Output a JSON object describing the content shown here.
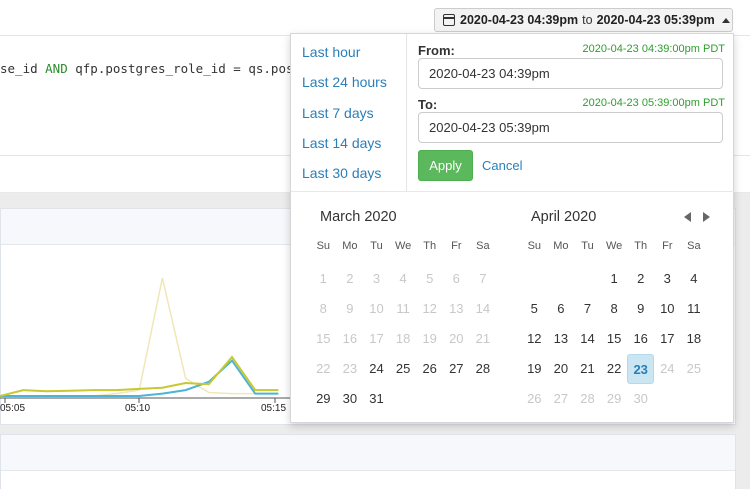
{
  "background": {
    "query_prefix": "se_id ",
    "query_and": "AND",
    "query_rest": " qfp.postgres_role_id = qs.postgr",
    "ticks": [
      "05:05",
      "05:10",
      "05:15"
    ]
  },
  "range_button": {
    "from": "2020-04-23 04:39pm",
    "to_word": "to",
    "to": "2020-04-23 05:39pm"
  },
  "presets": [
    "Last hour",
    "Last 24 hours",
    "Last 7 days",
    "Last 14 days",
    "Last 30 days"
  ],
  "form": {
    "from_label": "From:",
    "from_hint": "2020-04-23 04:39:00pm PDT",
    "from_value": "2020-04-23 04:39pm",
    "to_label": "To:",
    "to_hint": "2020-04-23 05:39:00pm PDT",
    "to_value": "2020-04-23 05:39pm",
    "apply_label": "Apply",
    "cancel_label": "Cancel"
  },
  "weekdays": [
    "Su",
    "Mo",
    "Tu",
    "We",
    "Th",
    "Fr",
    "Sa"
  ],
  "calendars": [
    {
      "title": "March 2020",
      "start_weekday": 0,
      "days_in_month": 31,
      "enabled_from": 24,
      "enabled_to": 31,
      "selected": null
    },
    {
      "title": "April 2020",
      "start_weekday": 3,
      "days_in_month": 30,
      "enabled_from": 1,
      "enabled_to": 23,
      "selected": 23
    }
  ],
  "chart_data": {
    "type": "line",
    "x_ticks": [
      "05:05",
      "05:10",
      "05:15"
    ],
    "series": [
      {
        "values": [
          0.0,
          0.05,
          0.04,
          0.045,
          0.05,
          0.05,
          0.06,
          0.07,
          0.11,
          0.1,
          0.33,
          0.05,
          0.05
        ],
        "color": "#c8c832"
      },
      {
        "values": [
          0.0,
          0.0,
          0.0,
          0.0,
          0.0,
          0.0,
          0.0,
          0.02,
          0.05,
          0.12,
          0.3,
          0.02,
          0.02
        ],
        "color": "#4bb4d8"
      },
      {
        "values": [
          0.0,
          0.0,
          0.0,
          0.0,
          0.0,
          0.02,
          0.05,
          1.0,
          0.15,
          0.03,
          0.02,
          0.02,
          0.02
        ],
        "color": "#f1e6b8"
      }
    ]
  }
}
